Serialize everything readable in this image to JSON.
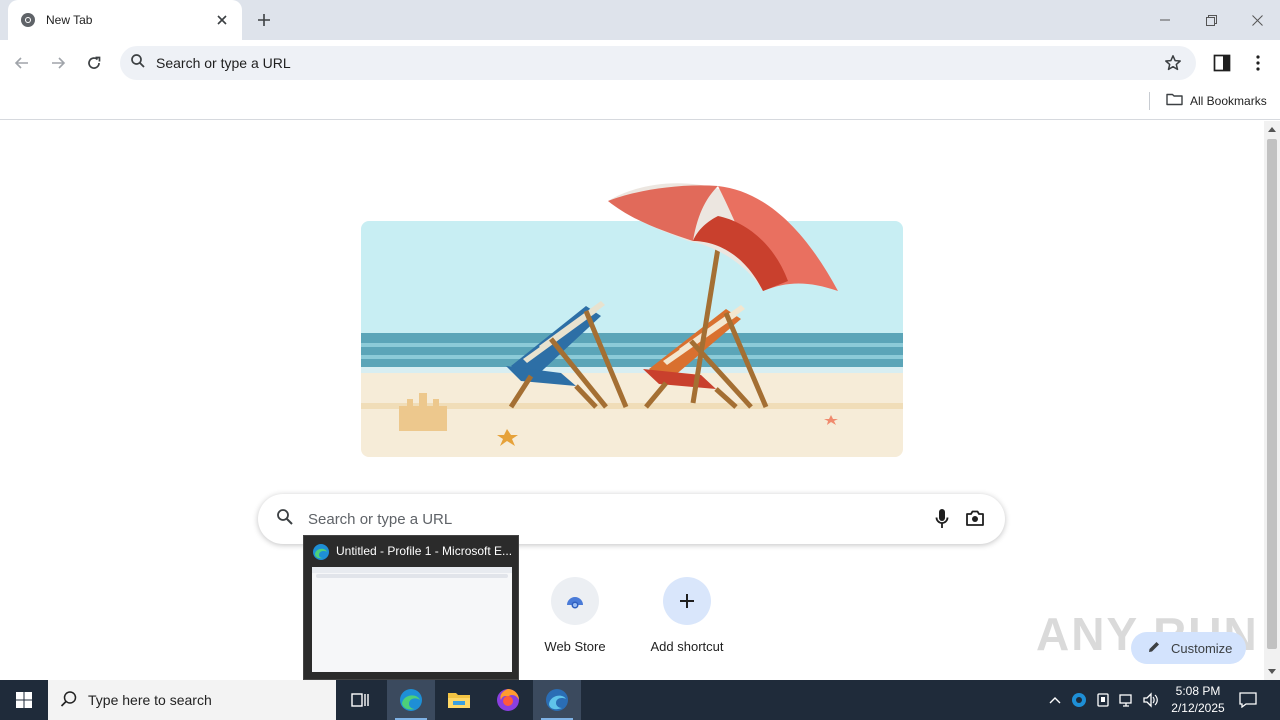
{
  "browser": {
    "tab": {
      "title": "New Tab"
    },
    "omnibox": {
      "text": "Search or type a URL"
    },
    "bookmarks": {
      "all_label": "All Bookmarks"
    }
  },
  "ntp": {
    "search_placeholder": "Search or type a URL",
    "shortcuts": [
      {
        "label": "Web Store"
      },
      {
        "label": "Add shortcut"
      }
    ],
    "customize_label": "Customize",
    "watermark": "ANY RUN"
  },
  "preview": {
    "title": "Untitled - Profile 1 - Microsoft E..."
  },
  "taskbar": {
    "search_placeholder": "Type here to search",
    "time": "5:08 PM",
    "date": "2/12/2025"
  },
  "colors": {
    "accent": "#0b57d0",
    "tabstrip": "#dee3eb",
    "taskbar": "#1f2b3a"
  }
}
